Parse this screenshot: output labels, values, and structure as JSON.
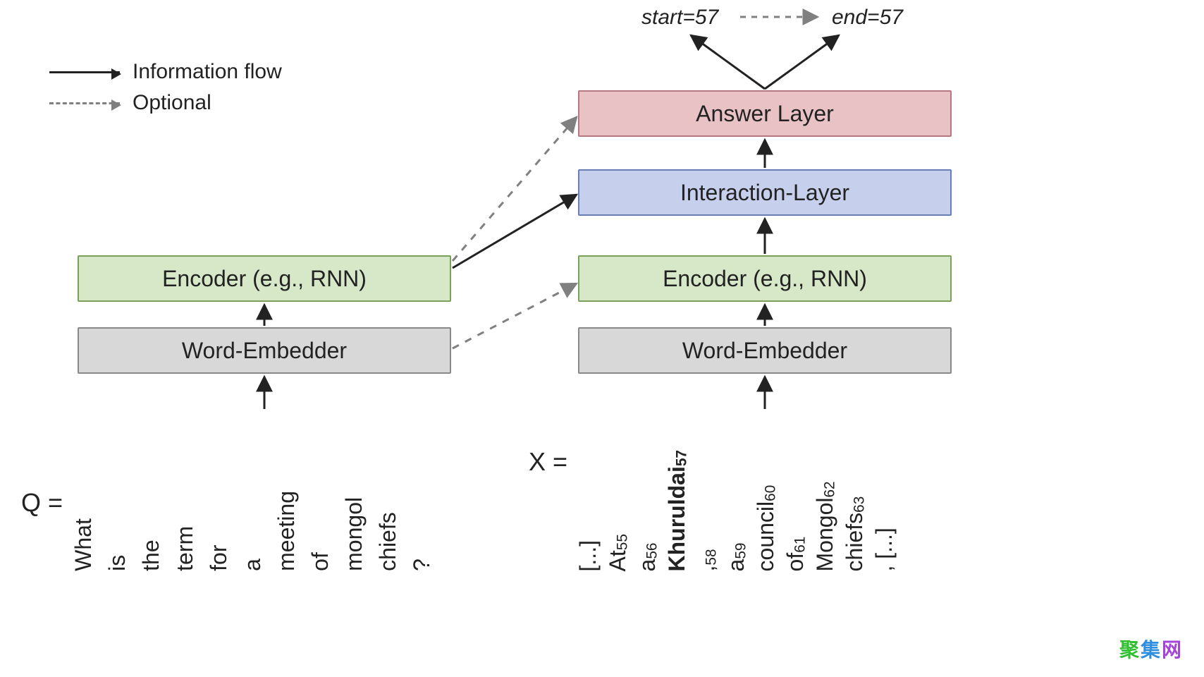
{
  "legend": {
    "info_flow": "Information flow",
    "optional": "Optional"
  },
  "boxes": {
    "q_embedder": "Word-Embedder",
    "q_encoder": "Encoder (e.g., RNN)",
    "x_embedder": "Word-Embedder",
    "x_encoder": "Encoder (e.g., RNN)",
    "interaction": "Interaction-Layer",
    "answer": "Answer Layer"
  },
  "outputs": {
    "start": "start=57",
    "end": "end=57"
  },
  "question": {
    "label": "Q =",
    "tokens": [
      "What",
      "is",
      "the",
      "term",
      "for",
      "a",
      "meeting",
      "of",
      "mongol",
      "chiefs",
      "?"
    ]
  },
  "context": {
    "label": "X =",
    "tokens": [
      {
        "text": "[...]",
        "sub": "",
        "bold": false
      },
      {
        "text": "At",
        "sub": "55",
        "bold": false
      },
      {
        "text": "a",
        "sub": "56",
        "bold": false
      },
      {
        "text": "Khuruldai",
        "sub": "57",
        "bold": true
      },
      {
        "text": ",",
        "sub": "58",
        "bold": false
      },
      {
        "text": "a",
        "sub": "59",
        "bold": false
      },
      {
        "text": "council",
        "sub": "60",
        "bold": false
      },
      {
        "text": "of",
        "sub": "61",
        "bold": false
      },
      {
        "text": "Mongol",
        "sub": "62",
        "bold": false
      },
      {
        "text": "chiefs",
        "sub": "63",
        "bold": false
      },
      {
        "text": ", [...]",
        "sub": "",
        "bold": false
      }
    ]
  },
  "watermark": {
    "a": "聚",
    "b": "集",
    "c": "网"
  }
}
